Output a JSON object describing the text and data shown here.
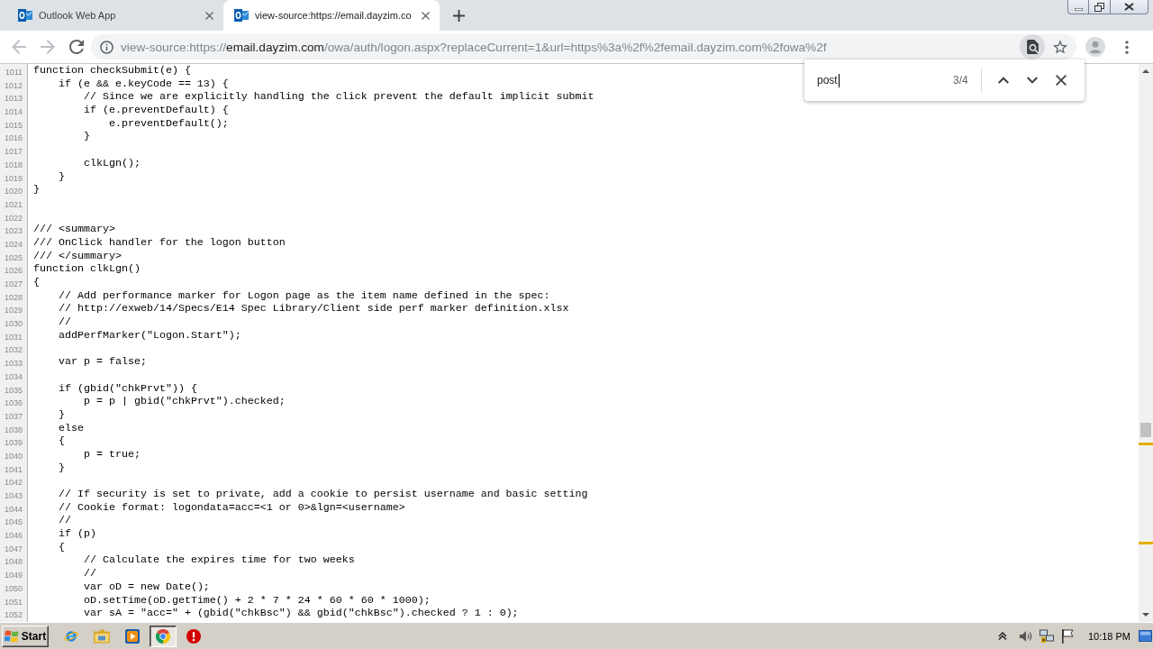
{
  "tabs": [
    {
      "title": "Outlook Web App",
      "selected": false
    },
    {
      "title": "view-source:https://email.dayzim.co",
      "selected": true
    }
  ],
  "nav_buttons": [
    {
      "kind": "back",
      "disabled": true
    },
    {
      "kind": "forward",
      "disabled": true
    },
    {
      "kind": "reload",
      "disabled": false
    }
  ],
  "address_bar": {
    "scheme": "view-source:https://",
    "host": "email.dayzim.com",
    "path": "/owa/auth/logon.aspx?replaceCurrent=1&url=https%3a%2f%2femail.dayzim.com%2fowa%2f"
  },
  "find_bar": {
    "value": "post",
    "count": "3/4"
  },
  "source_lines": [
    {
      "number": "1011",
      "text": "function checkSubmit(e) {"
    },
    {
      "number": "1012",
      "text": "    if (e && e.keyCode == 13) {"
    },
    {
      "number": "1013",
      "text": "        // Since we are explicitly handling the click prevent the default implicit submit"
    },
    {
      "number": "1014",
      "text": "        if (e.preventDefault) {"
    },
    {
      "number": "1015",
      "text": "            e.preventDefault();"
    },
    {
      "number": "1016",
      "text": "        }"
    },
    {
      "number": "1017"
    },
    {
      "number": "1018",
      "text": "        clkLgn();"
    },
    {
      "number": "1019",
      "text": "    }"
    },
    {
      "number": "1020",
      "text": "}"
    },
    {
      "number": "1021"
    },
    {
      "number": "1022"
    },
    {
      "number": "1023",
      "text": "/// <summary>"
    },
    {
      "number": "1024",
      "text": "/// OnClick handler for the logon button"
    },
    {
      "number": "1025",
      "text": "/// </summary>"
    },
    {
      "number": "1026",
      "text": "function clkLgn()"
    },
    {
      "number": "1027",
      "text": "{"
    },
    {
      "number": "1028",
      "text": "    // Add performance marker for Logon page as the item name defined in the spec:"
    },
    {
      "number": "1029",
      "text": "    // http://exweb/14/Specs/E14 Spec Library/Client side perf marker definition.xlsx"
    },
    {
      "number": "1030",
      "text": "    //"
    },
    {
      "number": "1031",
      "text": "    addPerfMarker(\"Logon.Start\");"
    },
    {
      "number": "1032"
    },
    {
      "number": "1033",
      "text": "    var p = false;"
    },
    {
      "number": "1034"
    },
    {
      "number": "1035",
      "text": "    if (gbid(\"chkPrvt\")) {"
    },
    {
      "number": "1036",
      "text": "        p = p | gbid(\"chkPrvt\").checked;"
    },
    {
      "number": "1037",
      "text": "    }"
    },
    {
      "number": "1038",
      "text": "    else"
    },
    {
      "number": "1039",
      "text": "    {"
    },
    {
      "number": "1040",
      "text": "        p = true;"
    },
    {
      "number": "1041",
      "text": "    }"
    },
    {
      "number": "1042"
    },
    {
      "number": "1043",
      "text": "    // If security is set to private, add a cookie to persist username and basic setting"
    },
    {
      "number": "1044",
      "text": "    // Cookie format: logondata=acc=<1 or 0>&lgn=<username>"
    },
    {
      "number": "1045",
      "text": "    //"
    },
    {
      "number": "1046",
      "text": "    if (p)"
    },
    {
      "number": "1047",
      "text": "    {"
    },
    {
      "number": "1048",
      "text": "        // Calculate the expires time for two weeks"
    },
    {
      "number": "1049",
      "text": "        //"
    },
    {
      "number": "1050",
      "text": "        var oD = new Date();"
    },
    {
      "number": "1051",
      "text": "        oD.setTime(oD.getTime() + 2 * 7 * 24 * 60 * 60 * 1000);"
    },
    {
      "number": "1052",
      "text": "        var sA = \"acc=\" + (gbid(\"chkBsc\") && gbid(\"chkBsc\").checked ? 1 : 0);"
    }
  ],
  "taskbar": {
    "start_label": "Start",
    "apps": [
      {
        "kind": "globe",
        "selected": false
      },
      {
        "kind": "folder",
        "selected": false
      },
      {
        "kind": "player",
        "selected": false
      },
      {
        "kind": "ring",
        "selected": true
      },
      {
        "kind": "stop",
        "selected": false
      }
    ],
    "clock": "10:18 PM"
  }
}
